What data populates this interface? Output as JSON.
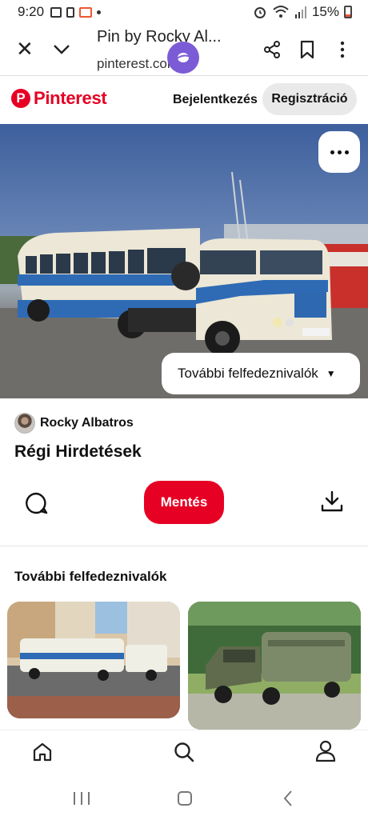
{
  "status_bar": {
    "time": "9:20",
    "battery": "15%"
  },
  "browser": {
    "title": "Pin by Rocky Al...",
    "url": "pinterest.com"
  },
  "header": {
    "logo_text": "Pinterest",
    "login_label": "Bejelentkezés",
    "signup_label": "Regisztráció"
  },
  "pin": {
    "explore_label": "További felfedeznivalók",
    "author": "Rocky Albatros",
    "title": "Régi Hirdetések",
    "save_label": "Mentés"
  },
  "more_section": {
    "heading": "További felfedeznivalók"
  },
  "colors": {
    "brand": "#e60023",
    "secondary_button": "#e9e9e9"
  }
}
